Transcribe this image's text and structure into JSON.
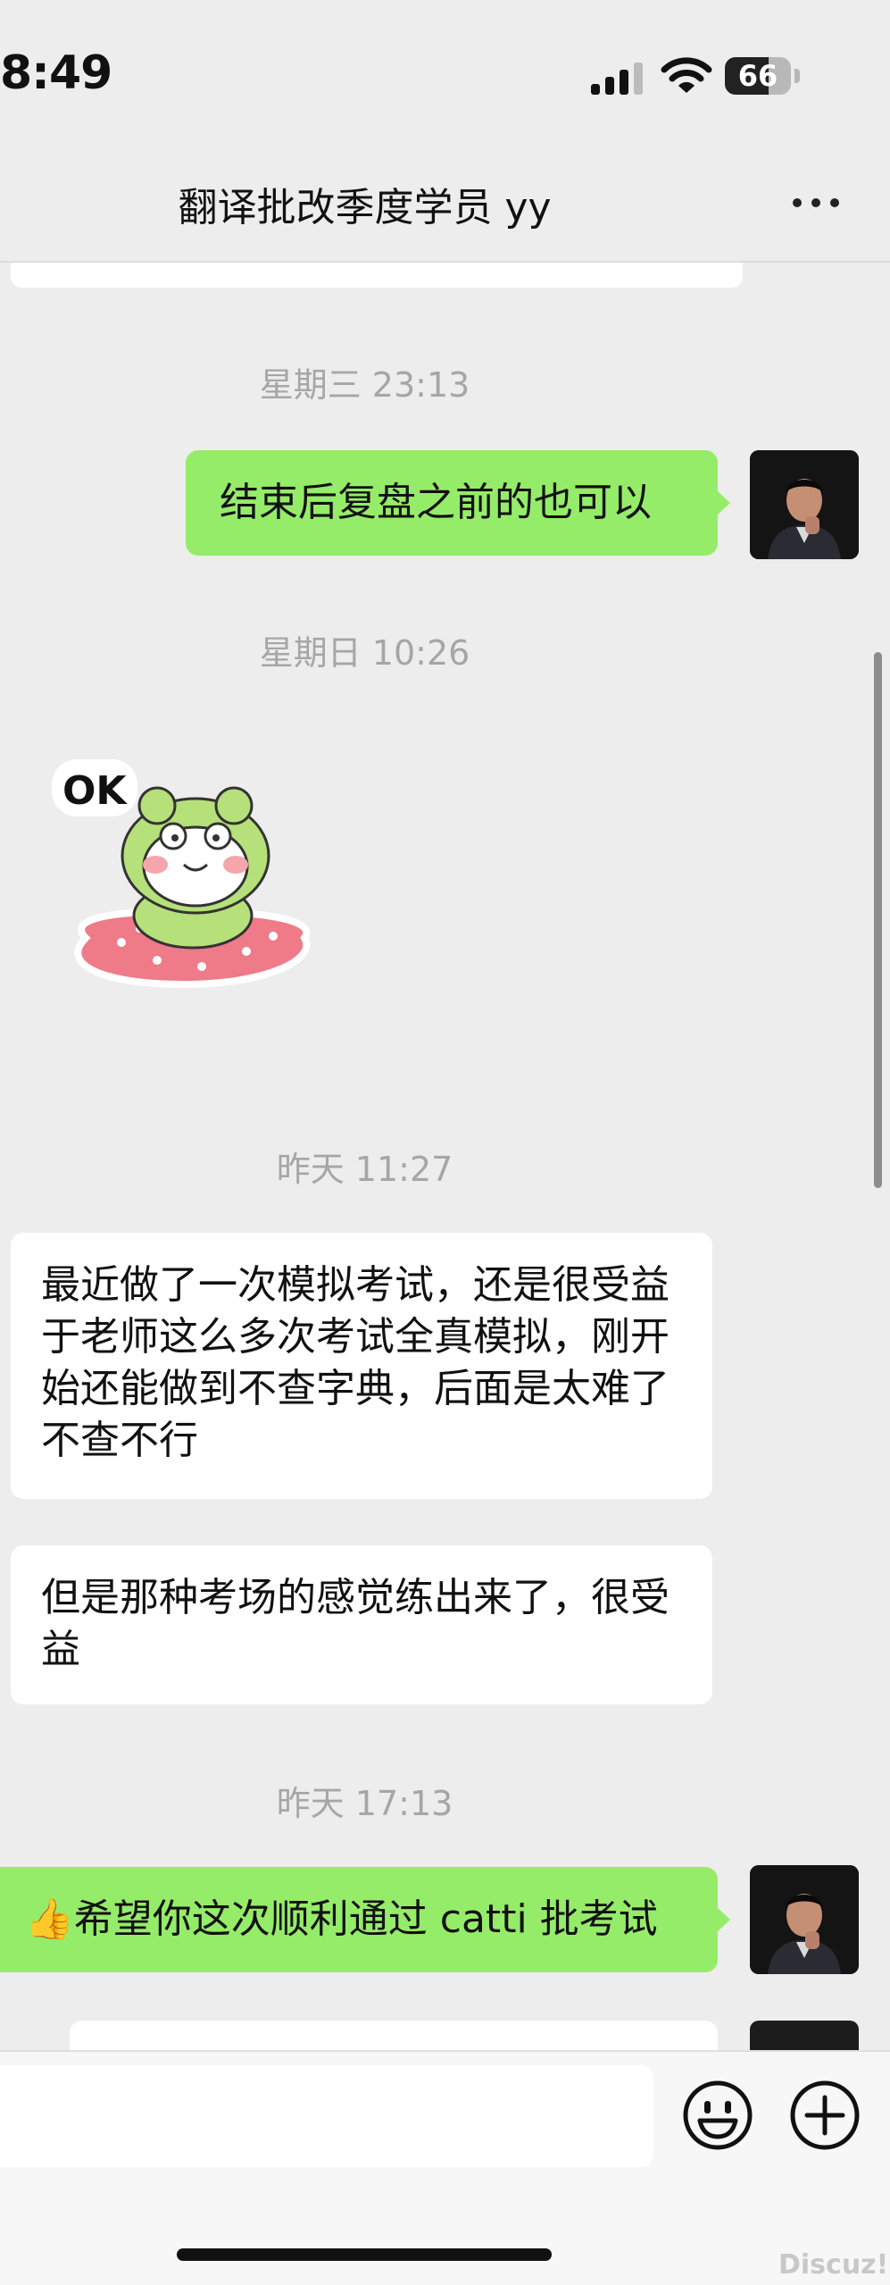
{
  "status_bar": {
    "time": "8:49",
    "battery": "66",
    "battery_level_pct": 66
  },
  "header": {
    "title": "翻译批改季度学员 yy",
    "more_icon": "more-dots-icon"
  },
  "timestamps": {
    "t1": "星期三 23:13",
    "t2": "星期日 10:26",
    "t3": "昨天 11:27",
    "t4": "昨天 17:13"
  },
  "messages": {
    "m1": "结束后复盘之前的也可以",
    "m2_sticker_text": "OK",
    "m3": "最近做了一次模拟考试，还是很受益于老师这么多次考试全真模拟，刚开始还能做到不查字典，后面是太难了不查不行",
    "m4": "但是那种考场的感觉练出来了，很受益",
    "m5_emoji": "👍",
    "m5": "希望你这次顺利通过 catti 批考试"
  },
  "input_bar": {
    "emoji_icon": "smiley-icon",
    "plus_icon": "plus-icon"
  },
  "watermark": "Discuz!",
  "colors": {
    "outgoing_bubble": "#95ec69",
    "incoming_bubble": "#ffffff",
    "background": "#ededed"
  }
}
